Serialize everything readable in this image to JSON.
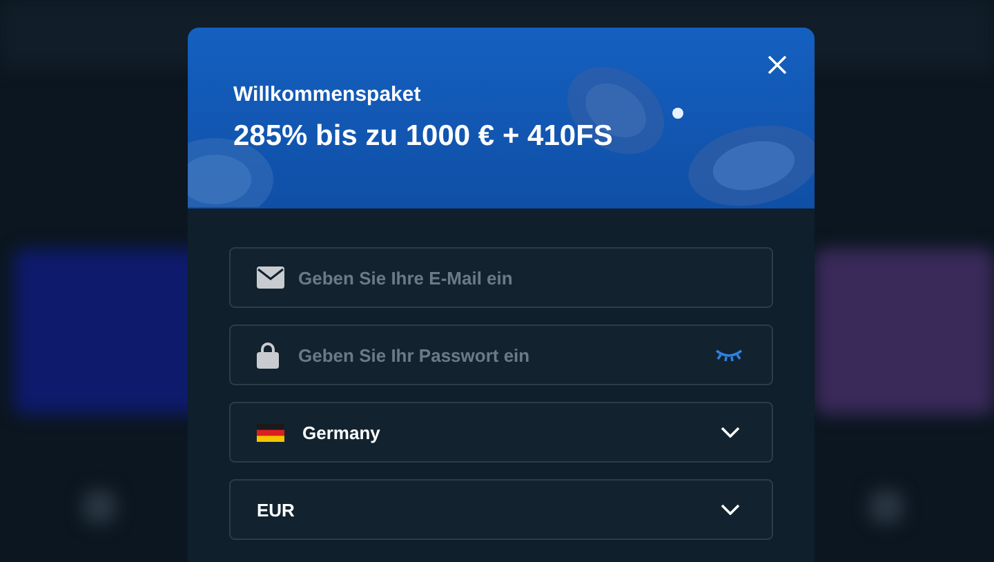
{
  "dialog": {
    "banner": {
      "subtitle": "Willkommenspaket",
      "title": "285% bis zu 1000 € + 410FS"
    },
    "fields": [
      {
        "kind": "email",
        "placeholder": "Geben Sie Ihre E-Mail ein"
      },
      {
        "kind": "password",
        "placeholder": "Geben Sie Ihr Passwort ein",
        "revealed": false
      },
      {
        "kind": "country",
        "value": "Germany"
      },
      {
        "kind": "currency",
        "value": "EUR"
      }
    ]
  }
}
